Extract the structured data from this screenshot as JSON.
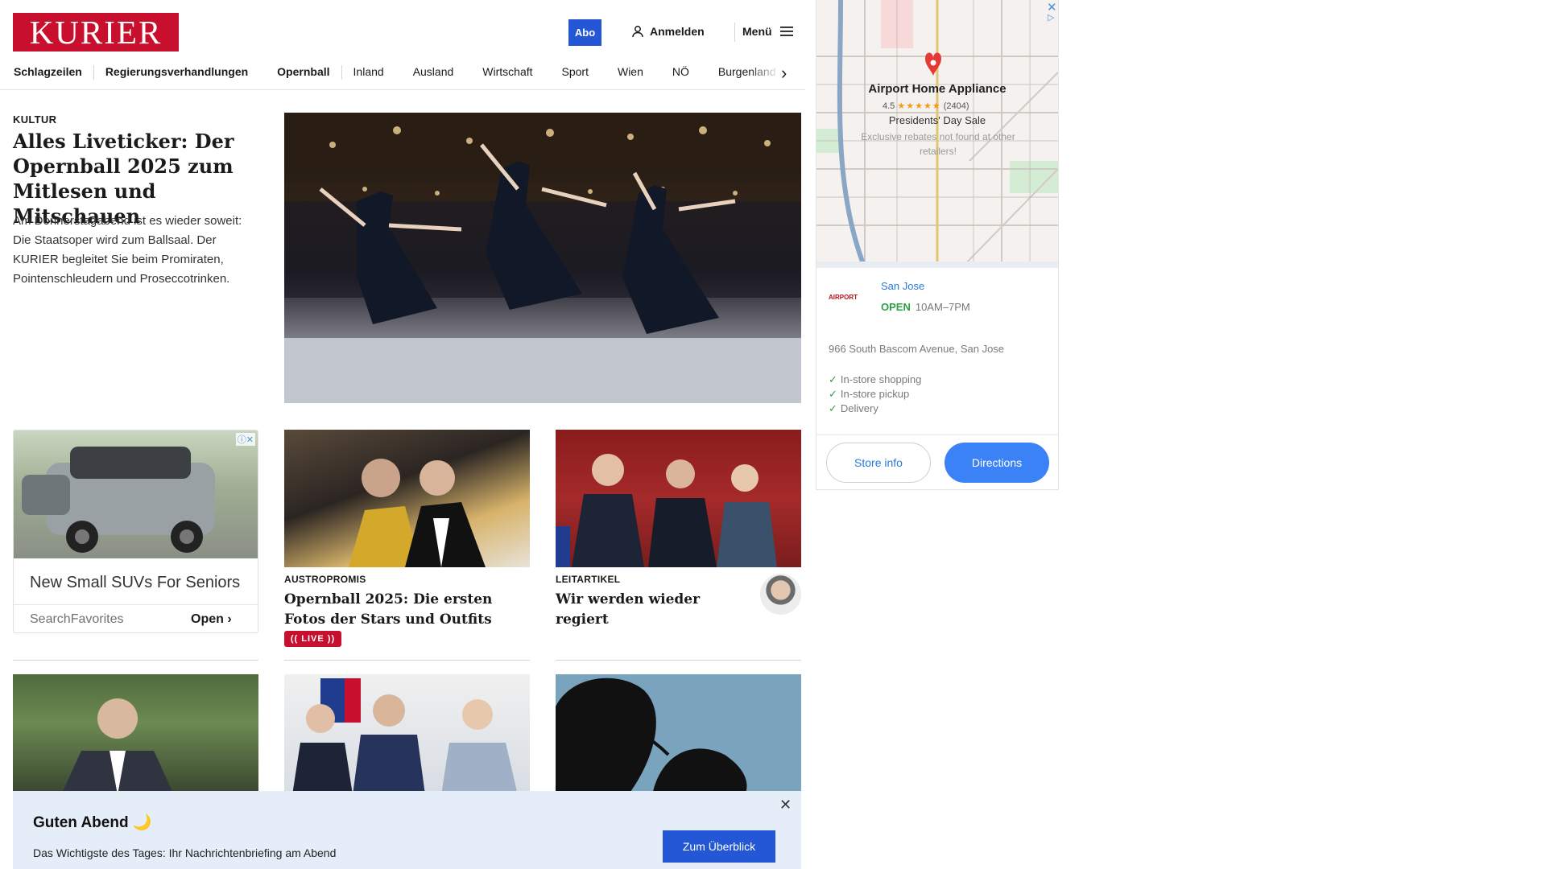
{
  "header": {
    "logo": "KURIER",
    "abo_label": "Abo",
    "login_label": "Anmelden",
    "menu_label": "Menü"
  },
  "nav": {
    "items": [
      "Schlagzeilen",
      "Regierungsverhandlungen",
      "Opernball",
      "Inland",
      "Ausland",
      "Wirtschaft",
      "Sport",
      "Wien",
      "NÖ",
      "Burgenland"
    ]
  },
  "hero": {
    "category": "KULTUR",
    "title": "Alles Liveticker: Der Opernball 2025 zum Mitlesen und Mitschauen",
    "text": "Am Donnerstagabend ist es wieder soweit: Die Staatsoper wird zum Ballsaal. Der KURIER begleitet Sie beim Promiraten, Pointenschleudern und Proseccotrinken."
  },
  "ad_left": {
    "title": "New Small SUVs For Seniors",
    "source": "SearchFavorites",
    "open_label": "Open"
  },
  "cards": [
    {
      "category": "AUSTROPROMIS",
      "title": "Opernball 2025: Die ersten Fotos der Stars und Outfits",
      "badge": "(( LIVE ))"
    },
    {
      "category": "LEITARTIKEL",
      "title": "Wir werden wieder regiert"
    }
  ],
  "side_ad": {
    "title": "Airport Home Appliance",
    "rating": "4.5",
    "review_count": "(2404)",
    "sale": "Presidents' Day Sale",
    "description": "Exclusive rebates not found at other retailers!",
    "store_logo": "AIRPORT",
    "location": "San Jose",
    "open_status": "OPEN",
    "hours": "10AM–7PM",
    "address": "966 South Bascom Avenue, San Jose",
    "features": [
      "In-store shopping",
      "In-store pickup",
      "Delivery"
    ],
    "store_info_label": "Store info",
    "directions_label": "Directions"
  },
  "banner": {
    "title": "Guten Abend 🌙",
    "text": "Das Wichtigste des Tages: Ihr Nachrichtenbriefing am Abend",
    "button_label": "Zum Überblick"
  },
  "colors": {
    "brand_red": "#c8102e",
    "accent_blue": "#2457d6",
    "banner_bg": "#e5eef8",
    "open_green": "#2ea043"
  }
}
